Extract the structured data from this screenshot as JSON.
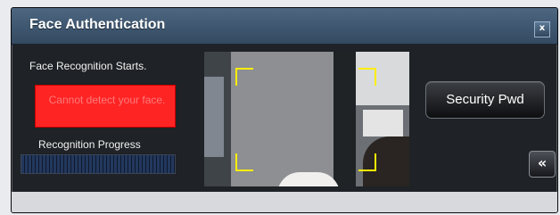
{
  "window": {
    "title": "Face Authentication",
    "close_label": "x"
  },
  "status": {
    "message": "Face Recognition Starts.",
    "error": "Cannot detect your face."
  },
  "progress": {
    "label": "Recognition Progress",
    "value_percent": 100
  },
  "buttons": {
    "security_pwd": "Security Pwd",
    "collapse": "«"
  },
  "colors": {
    "titlebar": "#3e566f",
    "error_bg": "#ff2424",
    "face_frame": "#ffee00"
  },
  "icons": {
    "collapse": "double-chevron-left-icon",
    "close": "close-icon"
  }
}
